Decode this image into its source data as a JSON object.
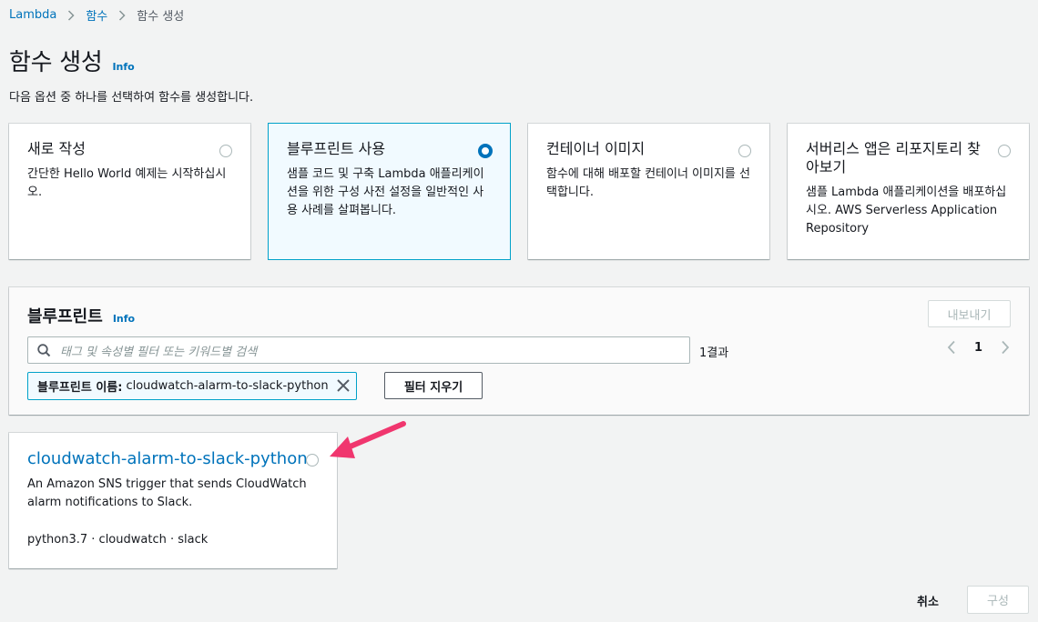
{
  "breadcrumb": {
    "root": "Lambda",
    "parent": "함수",
    "current": "함수 생성"
  },
  "page": {
    "title": "함수 생성",
    "info": "Info",
    "subtitle": "다음 옵션 중 하나를 선택하여 함수를 생성합니다."
  },
  "options": [
    {
      "title": "새로 작성",
      "desc": "간단한 Hello World 예제는 시작하십시오.",
      "selected": false
    },
    {
      "title": "블루프린트 사용",
      "desc": "샘플 코드 및 구축 Lambda 애플리케이션을 위한 구성 사전 설정을 일반적인 사용 사례를 살펴봅니다.",
      "selected": true
    },
    {
      "title": "컨테이너 이미지",
      "desc": "함수에 대해 배포할 컨테이너 이미지를 선택합니다.",
      "selected": false
    },
    {
      "title": "서버리스 앱은 리포지토리 찾아보기",
      "desc": "샘플 Lambda 애플리케이션을 배포하십시오. AWS Serverless Application Repository",
      "selected": false
    }
  ],
  "blueprints": {
    "heading": "블루프린트",
    "info": "Info",
    "export_label": "내보내기",
    "search_placeholder": "태그 및 속성별 필터 또는 키워드별 검색",
    "result_count": "1결과",
    "page": "1",
    "filter_token_key": "블루프린트 이름:",
    "filter_token_value": "cloudwatch-alarm-to-slack-python",
    "clear_filter_label": "필터 지우기"
  },
  "result_card": {
    "name": "cloudwatch-alarm-to-slack-python",
    "desc": "An Amazon SNS trigger that sends CloudWatch alarm notifications to Slack.",
    "tags": "python3.7 · cloudwatch · slack"
  },
  "footer": {
    "cancel_label": "취소",
    "create_label": "구성"
  },
  "colors": {
    "link": "#0073bb",
    "accent_border": "#00a1c9",
    "annotation_arrow": "#f0366e"
  }
}
